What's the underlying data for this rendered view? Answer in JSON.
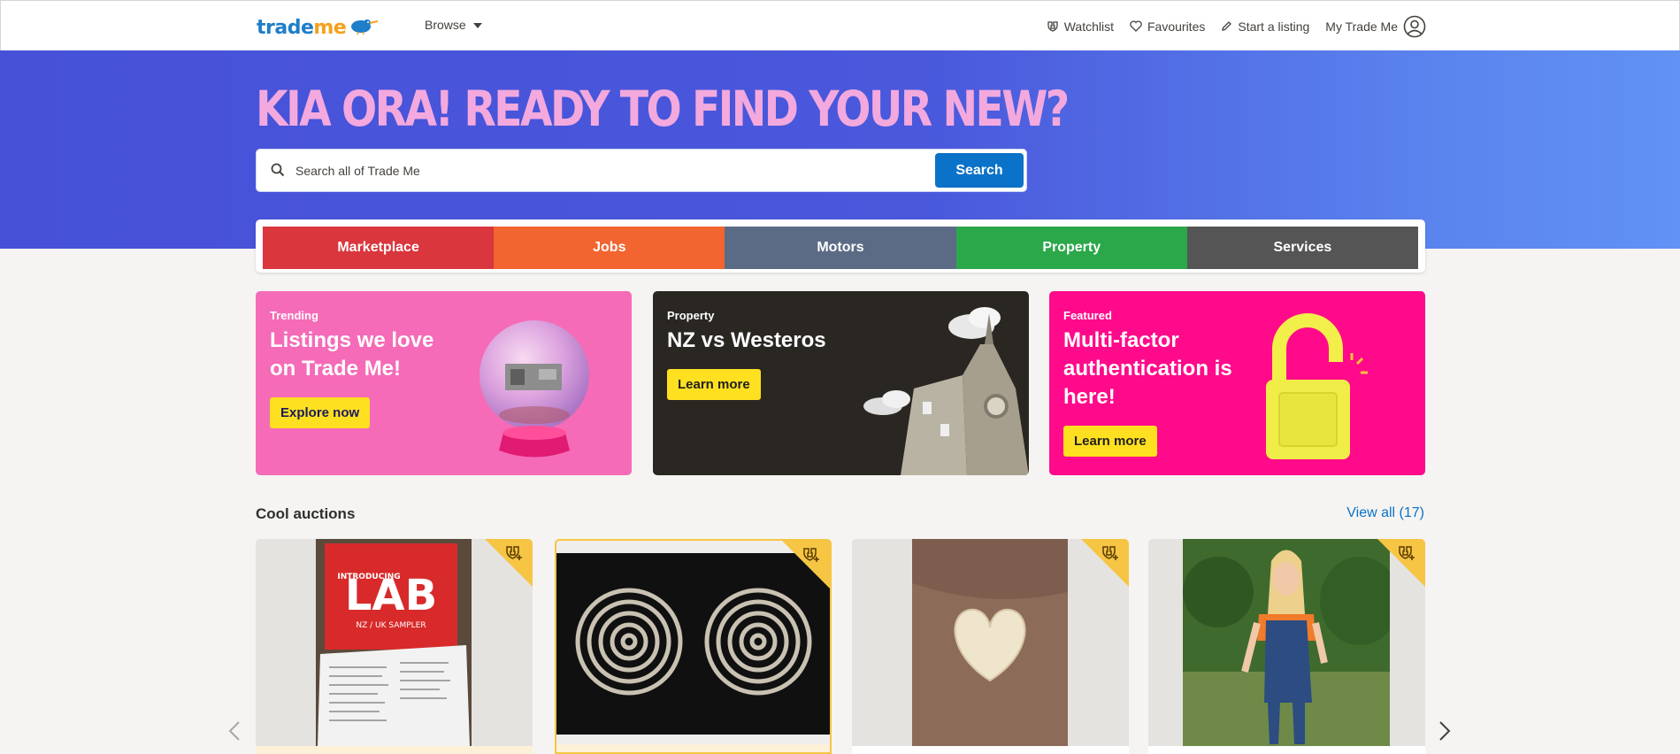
{
  "header": {
    "logo": {
      "part1": "trade",
      "part2": "me"
    },
    "browse_label": "Browse",
    "watchlist_label": "Watchlist",
    "favourites_label": "Favourites",
    "start_listing_label": "Start a listing",
    "my_trade_me_label": "My Trade Me"
  },
  "hero": {
    "title": "KIA ORA! READY TO FIND YOUR NEW?",
    "search_placeholder": "Search all of Trade Me",
    "search_button": "Search"
  },
  "categories": [
    {
      "label": "Marketplace",
      "color": "#d9363e"
    },
    {
      "label": "Jobs",
      "color": "#f26430"
    },
    {
      "label": "Motors",
      "color": "#5b6b85"
    },
    {
      "label": "Property",
      "color": "#2aa84a"
    },
    {
      "label": "Services",
      "color": "#555555"
    }
  ],
  "promos": [
    {
      "eyebrow": "Trending",
      "title_line1": "Listings we love",
      "title_line2": "on Trade Me!",
      "button": "Explore now",
      "color": "#f56bb7"
    },
    {
      "eyebrow": "Property",
      "title_line1": "NZ vs Westeros",
      "button": "Learn more",
      "color": "#2a2622"
    },
    {
      "eyebrow": "Featured",
      "title_line1": "Multi-factor",
      "title_line2": "authentication is",
      "title_line3": "here!",
      "button": "Learn more",
      "color": "#ff0a8a"
    }
  ],
  "auctions": {
    "title": "Cool auctions",
    "view_all": "View all (17)",
    "items": [
      {
        "image": "lab-book-photo",
        "image_text_1": "INTRODUCING",
        "image_text_2": "LAB",
        "image_text_3": "NZ / UK SAMPLER"
      },
      {
        "image": "twin-spiral-art-photo"
      },
      {
        "image": "heart-potato-photo"
      },
      {
        "image": "woman-in-garden-photo"
      }
    ]
  },
  "colors": {
    "accent_blue": "#0a72c8",
    "auction_corner": "#f6c544",
    "hero_title": "#f3a9dd",
    "logo_blue": "#1e7ec8",
    "logo_orange": "#f3a21c"
  }
}
